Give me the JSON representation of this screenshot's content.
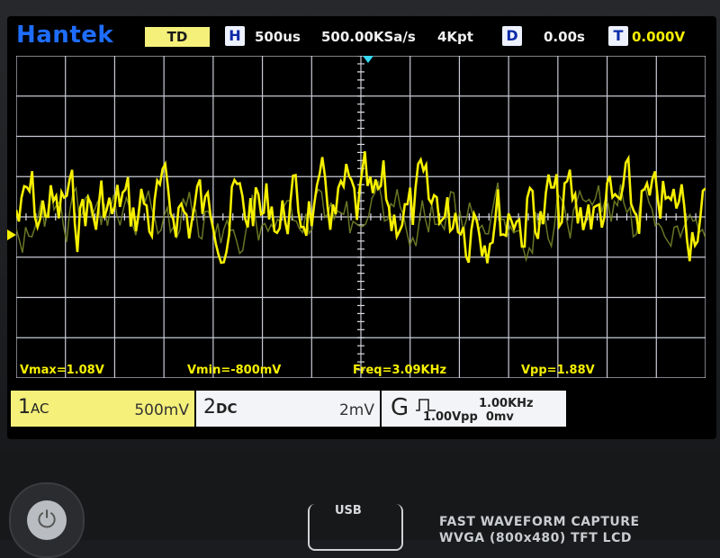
{
  "brand": {
    "name": "Hantek",
    "color": "#1e6dff"
  },
  "top": {
    "mode": "TD",
    "h_label": "H",
    "timebase": "500us",
    "sample_rate": "500.00KSa/s",
    "memory": "4Kpt",
    "d_label": "D",
    "delay": "0.00s",
    "t_label": "T",
    "trigger_level": "0.000V"
  },
  "measurements": {
    "vmax": "Vmax=1.08V",
    "vmin": "Vmin=-800mV",
    "freq": "Freq=3.09KHz",
    "vpp": "Vpp=1.88V"
  },
  "channels": {
    "ch1": {
      "number": "1",
      "coupling": "AC",
      "scale": "500mV",
      "color": "#f6f000"
    },
    "ch2": {
      "number": "2",
      "coupling": "DC",
      "scale": "2mV",
      "color": "#8a9a2a"
    }
  },
  "generator": {
    "label": "G",
    "freq": "1.00KHz",
    "amplitude": "1.00Vpp",
    "offset": "0mv"
  },
  "panel": {
    "usb": "USB",
    "line1": "FAST WAVEFORM CAPTURE",
    "line2": "WVGA (800x480) TFT LCD"
  },
  "icons": {
    "power": "power-icon",
    "ground_marker": "channel-ground-marker-icon",
    "trigger_marker": "trigger-position-marker-icon",
    "square_wave": "square-wave-icon"
  }
}
